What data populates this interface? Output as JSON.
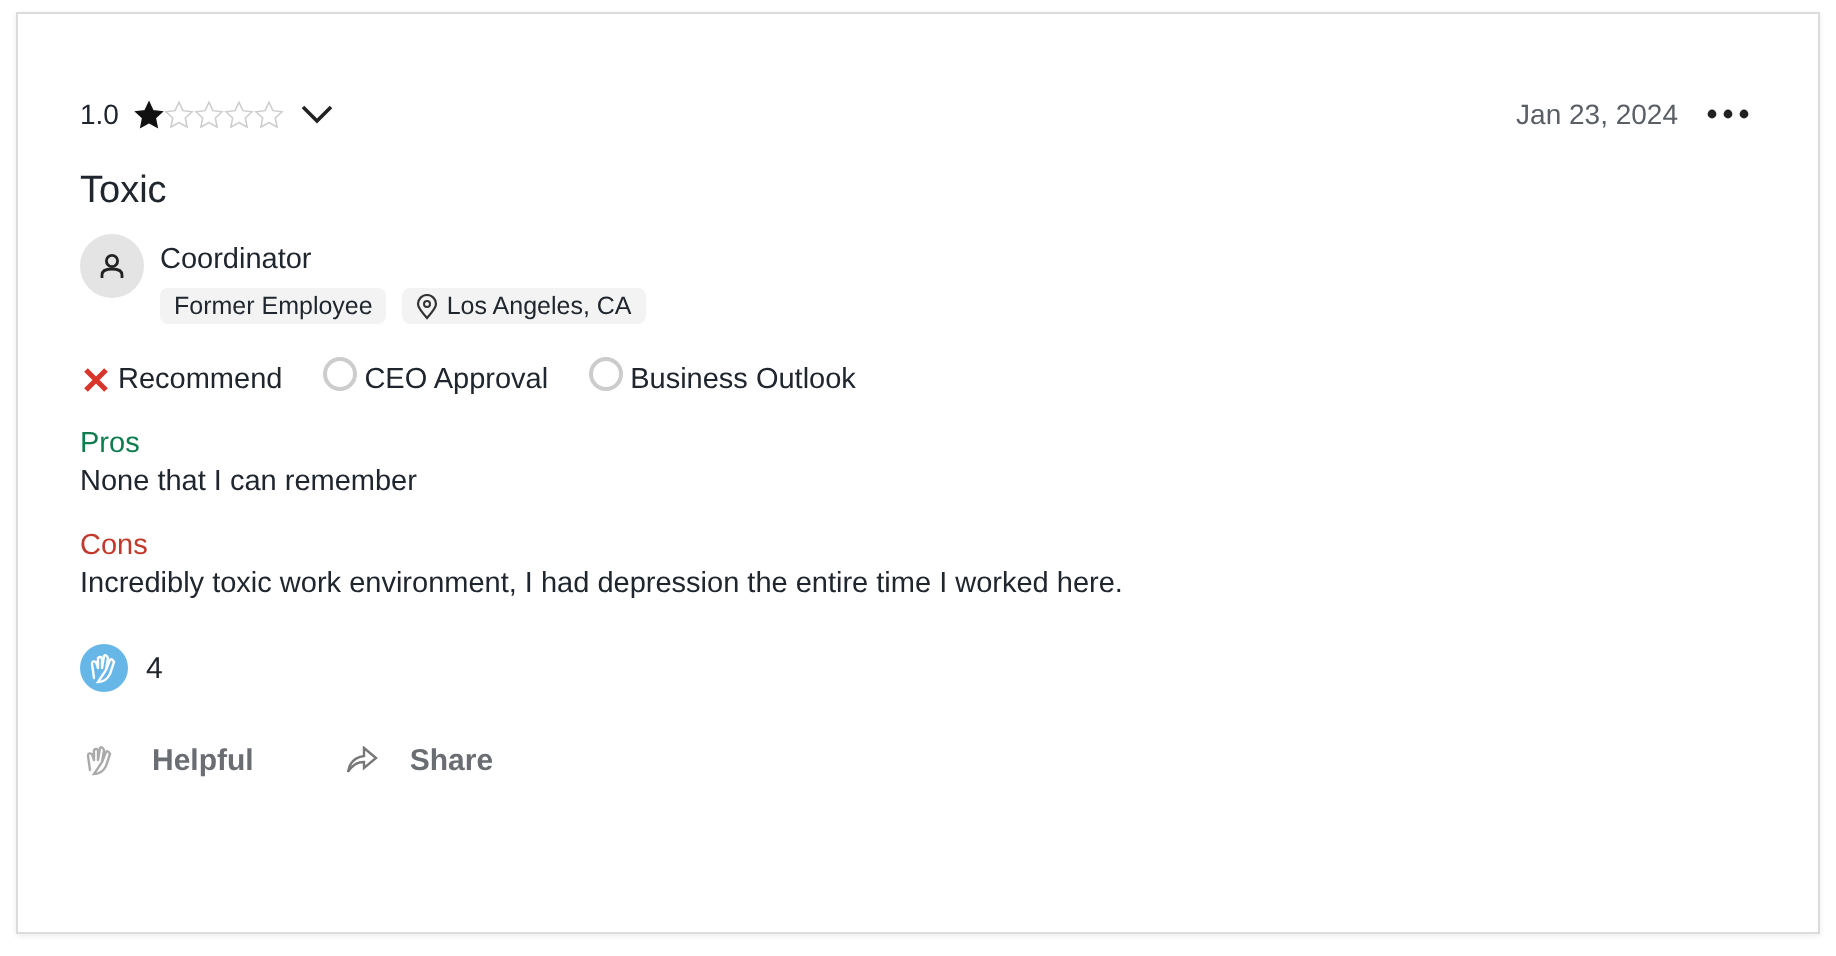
{
  "review": {
    "rating": "1.0",
    "stars": 1,
    "date": "Jan 23, 2024",
    "title": "Toxic",
    "job_title": "Coordinator",
    "tags": [
      {
        "kind": "status",
        "label": "Former Employee"
      },
      {
        "kind": "location",
        "label": "Los Angeles, CA"
      }
    ],
    "ratings": [
      {
        "label": "Recommend",
        "kind": "negative"
      },
      {
        "label": "CEO Approval",
        "kind": "none"
      },
      {
        "label": "Business Outlook",
        "kind": "none"
      }
    ],
    "sections": [
      {
        "kind": "pros",
        "heading": "Pros",
        "text": "None that I can remember"
      },
      {
        "kind": "cons",
        "heading": "Cons",
        "text": "Incredibly toxic work environment, I had depression the entire time I worked here."
      }
    ],
    "helpful_count": "4",
    "actions": [
      {
        "kind": "helpful",
        "label": "Helpful"
      },
      {
        "kind": "share",
        "label": "Share"
      }
    ]
  }
}
